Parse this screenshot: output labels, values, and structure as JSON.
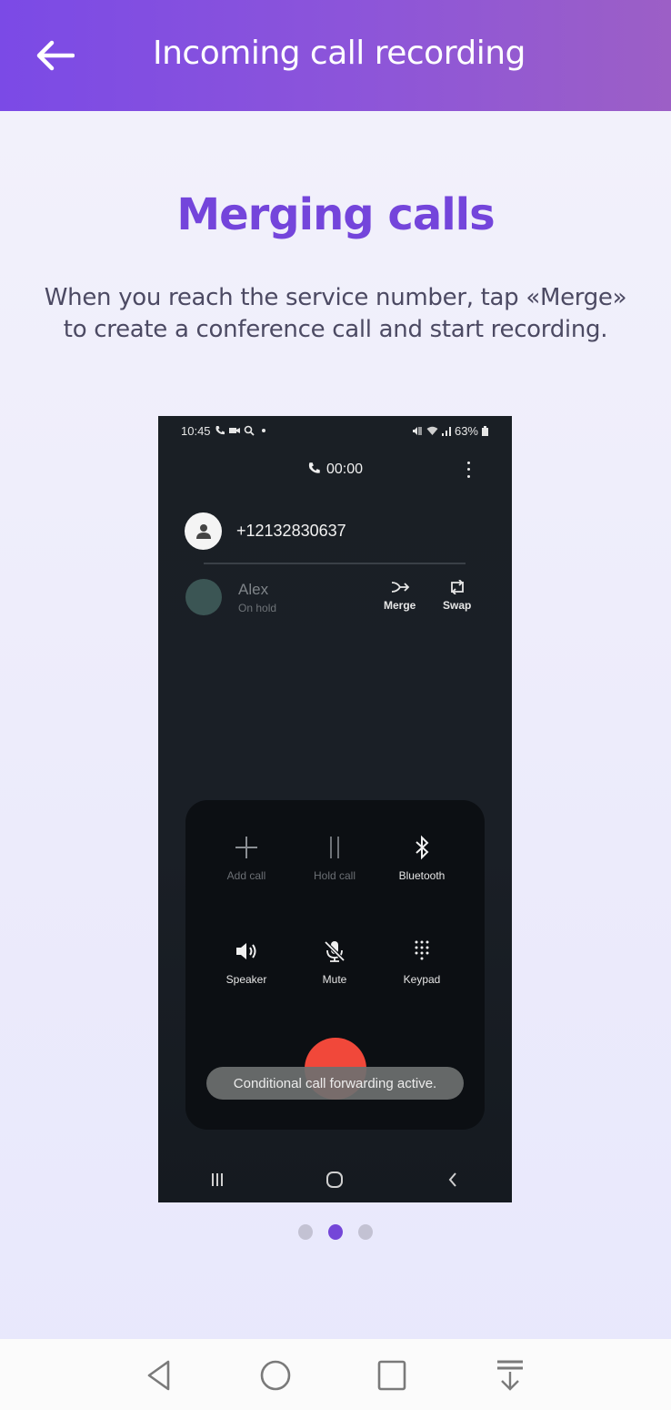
{
  "header": {
    "title": "Incoming call recording",
    "back_icon": "arrow-left-icon",
    "colors": {
      "gradient_start": "#7b4ae6",
      "gradient_end": "#9c5fc6"
    }
  },
  "slide": {
    "title": "Merging calls",
    "description": "When you reach the service number, tap «Merge» to create a conference call and start recording.",
    "accent": "#7445db"
  },
  "phone_screenshot": {
    "status_bar": {
      "time": "10:45",
      "battery": "63%"
    },
    "call_timer": "00:00",
    "active_caller": "+12132830637",
    "held_caller": {
      "name": "Alex",
      "status": "On hold"
    },
    "actions": [
      {
        "label": "Merge",
        "icon": "merge-icon"
      },
      {
        "label": "Swap",
        "icon": "swap-icon"
      }
    ],
    "controls": [
      {
        "label": "Add call",
        "icon": "plus-icon",
        "enabled": false
      },
      {
        "label": "Hold call",
        "icon": "pause-icon",
        "enabled": false
      },
      {
        "label": "Bluetooth",
        "icon": "bluetooth-icon",
        "enabled": true
      },
      {
        "label": "Speaker",
        "icon": "speaker-icon",
        "enabled": true
      },
      {
        "label": "Mute",
        "icon": "mic-off-icon",
        "enabled": true
      },
      {
        "label": "Keypad",
        "icon": "keypad-icon",
        "enabled": true
      }
    ],
    "toast": "Conditional call forwarding active.",
    "end_call_color": "#f1483a"
  },
  "pager": {
    "total": 3,
    "current": 2,
    "active_color": "#7446d8"
  },
  "system_nav": [
    "back-icon",
    "home-icon",
    "recents-icon",
    "notification-pull-icon"
  ]
}
